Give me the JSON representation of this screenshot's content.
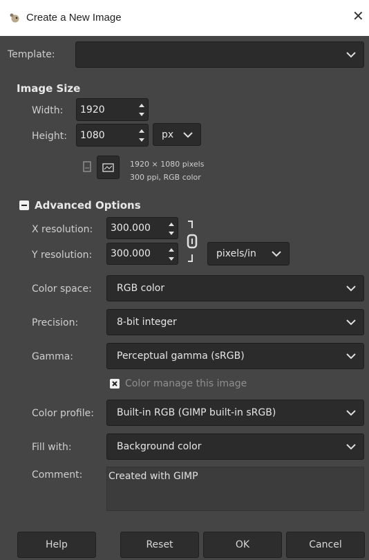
{
  "window": {
    "title": "Create a New Image",
    "close_glyph": "✕"
  },
  "template": {
    "label": "Template:",
    "value": ""
  },
  "image_size": {
    "heading": "Image Size",
    "width_label": "Width:",
    "width_value": "1920",
    "height_label": "Height:",
    "height_value": "1080",
    "unit": "px",
    "info_line1": "1920 × 1080 pixels",
    "info_line2": "300 ppi, RGB color"
  },
  "advanced": {
    "toggle_glyph": "−",
    "heading": "Advanced Options",
    "xres_label": "X resolution:",
    "xres_value": "300.000",
    "yres_label": "Y resolution:",
    "yres_value": "300.000",
    "res_unit": "pixels/in",
    "color_space_label": "Color space:",
    "color_space_value": "RGB color",
    "precision_label": "Precision:",
    "precision_value": "8-bit integer",
    "gamma_label": "Gamma:",
    "gamma_value": "Perceptual gamma (sRGB)",
    "color_manage_label": "Color manage this image",
    "color_manage_checked": true,
    "color_profile_label": "Color profile:",
    "color_profile_value": "Built-in RGB (GIMP built-in sRGB)",
    "fill_label": "Fill with:",
    "fill_value": "Background color",
    "comment_label": "Comment:",
    "comment_value": "Created with GIMP"
  },
  "buttons": {
    "help": "Help",
    "reset": "Reset",
    "ok": "OK",
    "cancel": "Cancel"
  },
  "colors": {
    "bg": "#454545",
    "field": "#2b2b2b",
    "titlebar": "#ffffff"
  }
}
